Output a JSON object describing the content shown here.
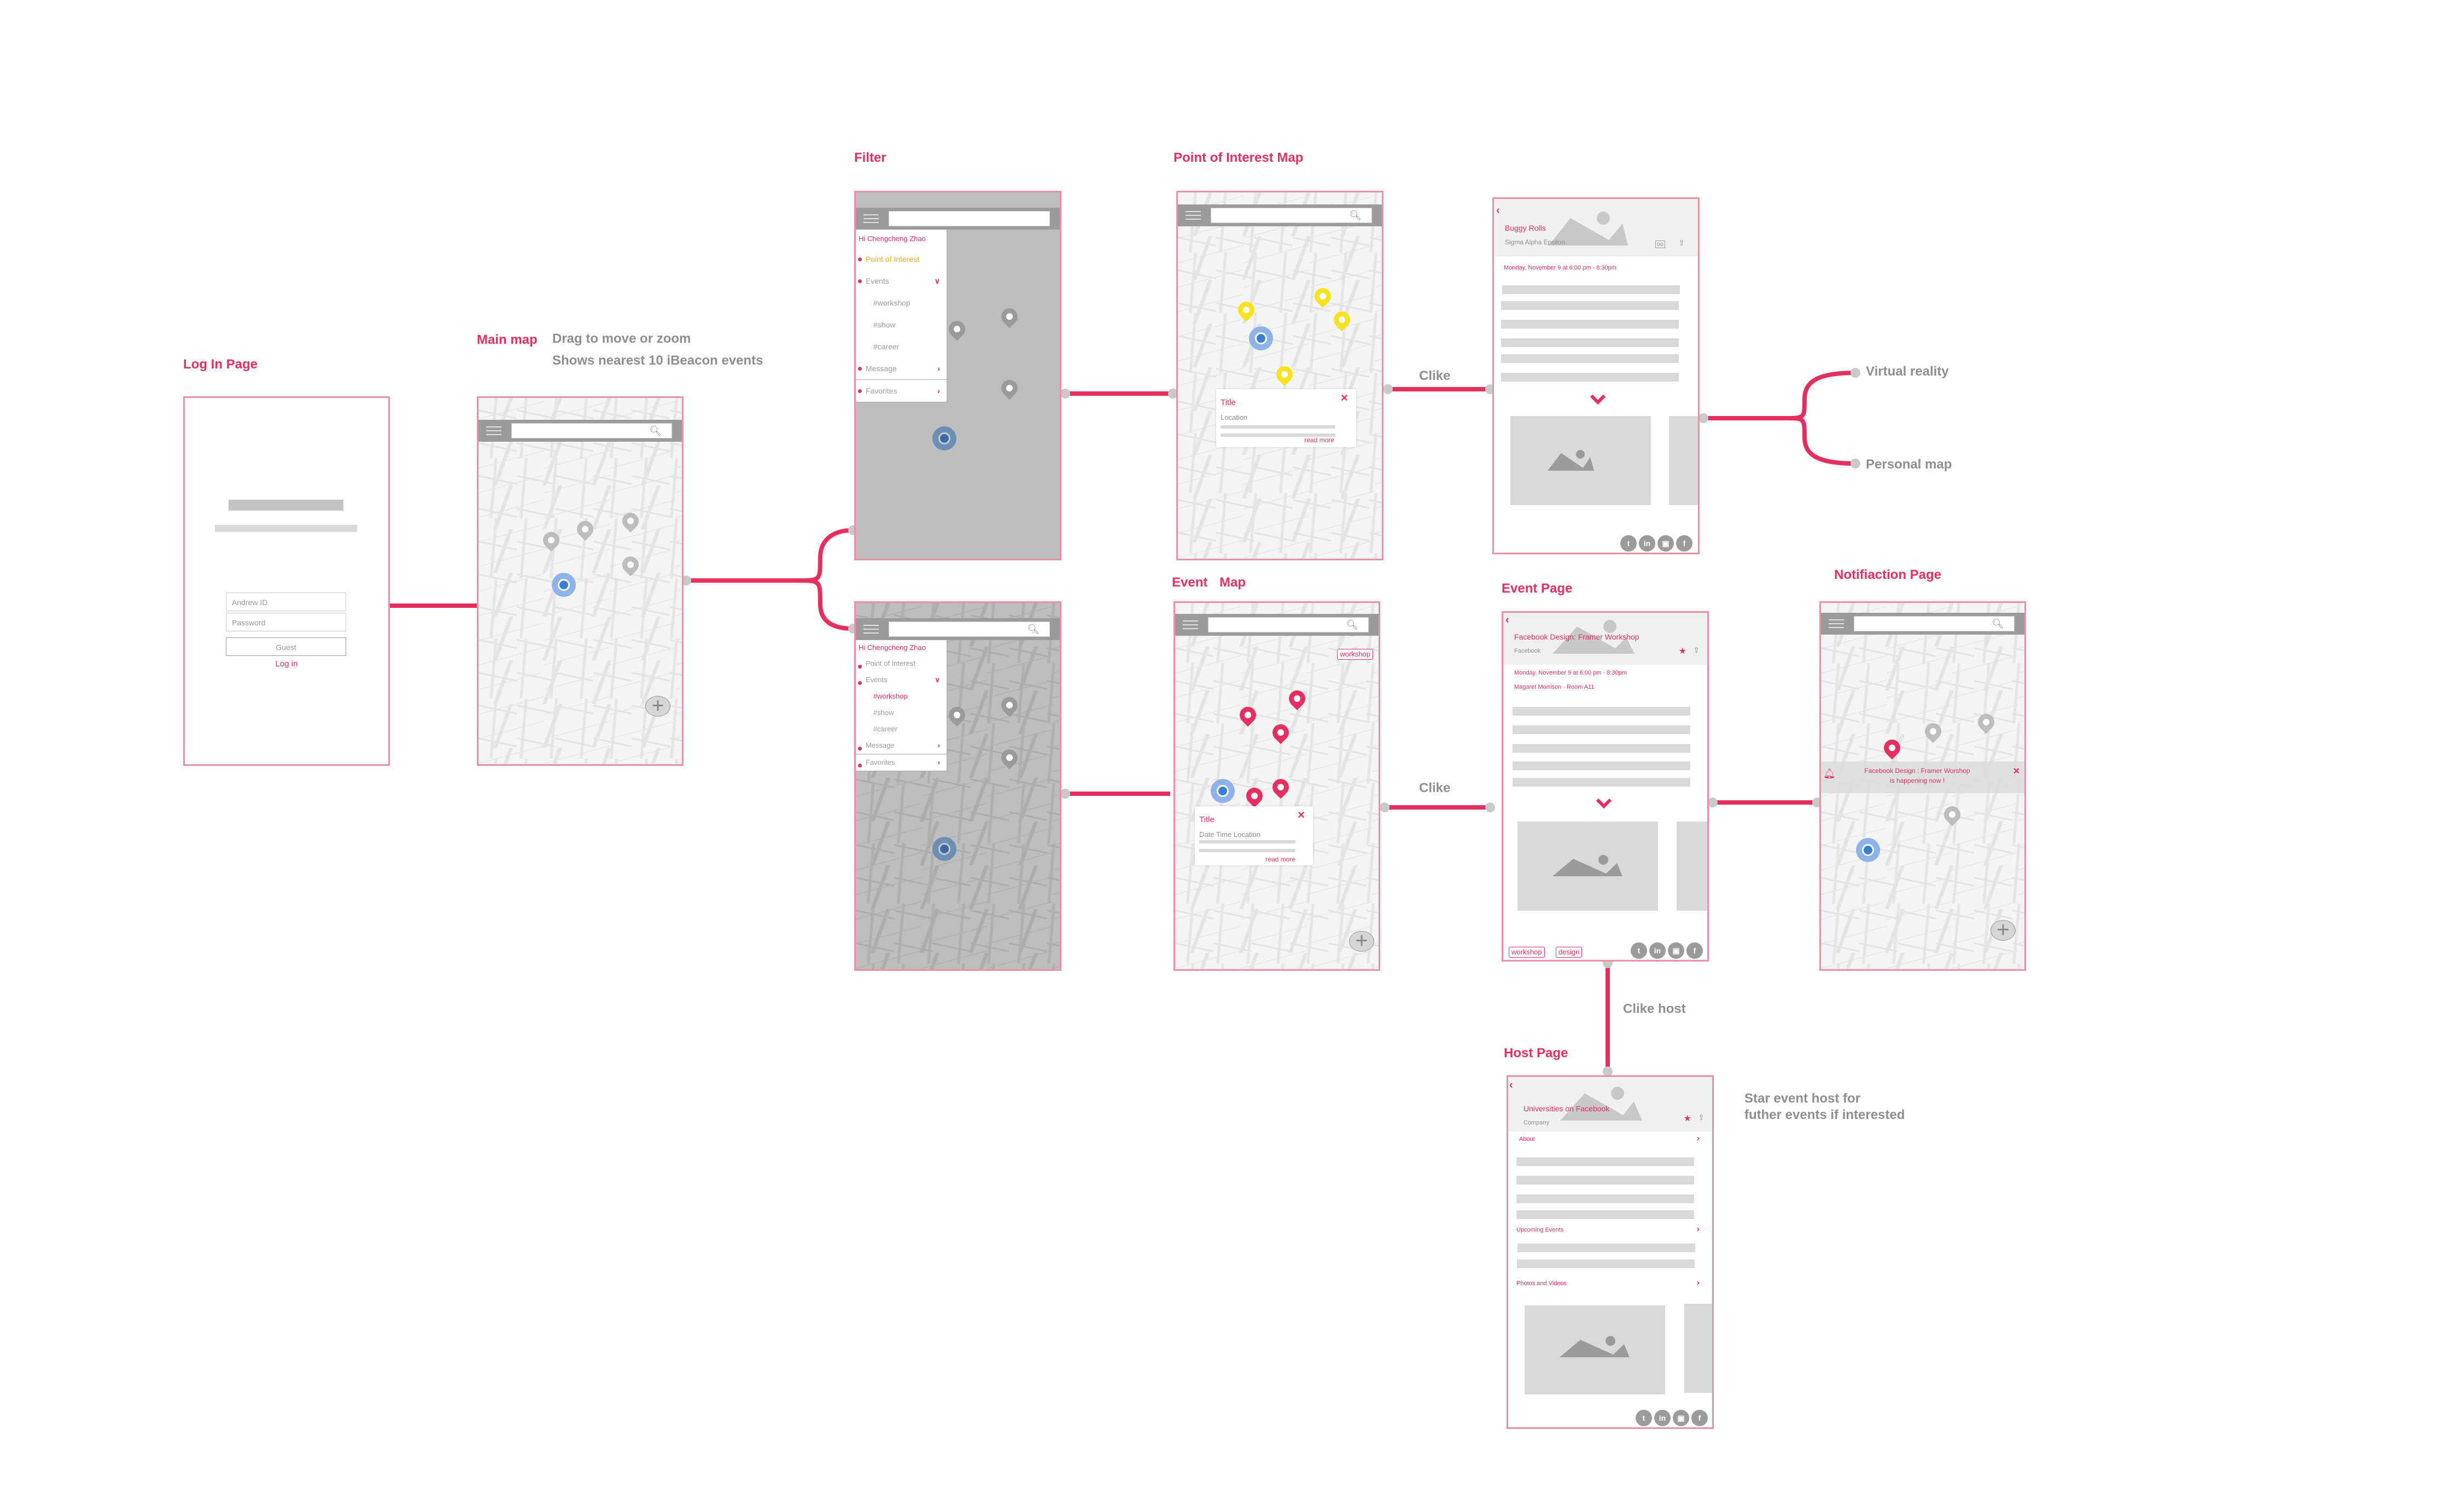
{
  "colors": {
    "accent": "#e5305f",
    "frame_border": "#eb8fa6",
    "note_text": "#8e8e8e",
    "poi_pin": "#f6e21f",
    "event_pin": "#e5305f",
    "location": "#3a7ed0"
  },
  "labels": {
    "login": "Log In Page",
    "main_map": "Main map",
    "filter": "Filter",
    "poi_map": "Point of Interest Map",
    "event_map_a": "Event",
    "event_map_b": "Map",
    "event_page": "Event Page",
    "notification": "Notifiaction Page",
    "host": "Host Page"
  },
  "notes": {
    "main_map_1": "Drag to move or zoom",
    "main_map_2": "Shows nearest 10 iBeacon events",
    "click_poi": "Clike",
    "click_event": "Clike",
    "click_host": "Clike host",
    "branch_vr": "Virtual reality",
    "branch_personal": "Personal map",
    "star_host_1": "Star event host for",
    "star_host_2": "futher events if interested"
  },
  "login": {
    "andrew_id_placeholder": "Andrew ID",
    "password_placeholder": "Password",
    "guest_button": "Guest",
    "login_link": "Log in"
  },
  "search_icon": "search-icon",
  "menu": {
    "greeting": "Hi Chengcheng Zhao",
    "items": [
      "Point of Interest",
      "Events",
      "#workshop",
      "#show",
      "#career",
      "Message",
      "Favorites"
    ],
    "top_selected": "Point of Interest",
    "bottom_selected": "#workshop"
  },
  "poi_popup": {
    "title": "Title",
    "subtitle": "Location",
    "read_more": "read more"
  },
  "event_popup": {
    "title": "Title",
    "subtitle": "Date  Time  Location",
    "read_more": "read more",
    "filter_tag": "workshop"
  },
  "buggy": {
    "title": "Buggy Rolls",
    "host": "Sigma Alpha Epsilon",
    "datetime": "Monday, November 9 at 6:00 pm - 8:30pm"
  },
  "event_page": {
    "title": "Facebook Design: Framer Workshop",
    "host": "Facebook",
    "datetime": "Monday, November 9 at 6:00 pm - 8:30pm",
    "location": "Magaret Morrison - Room A11",
    "tags": [
      "workshop",
      "design"
    ]
  },
  "notification": {
    "line1": "Facebook Design : Framer Worshop",
    "line2": "is happening now !"
  },
  "host_page": {
    "title": "Universities on Facebook",
    "type": "Company",
    "sections": [
      "About",
      "Upcoming Events",
      "Photos and Videos"
    ]
  },
  "social": [
    "t",
    "in",
    "ig",
    "f"
  ]
}
